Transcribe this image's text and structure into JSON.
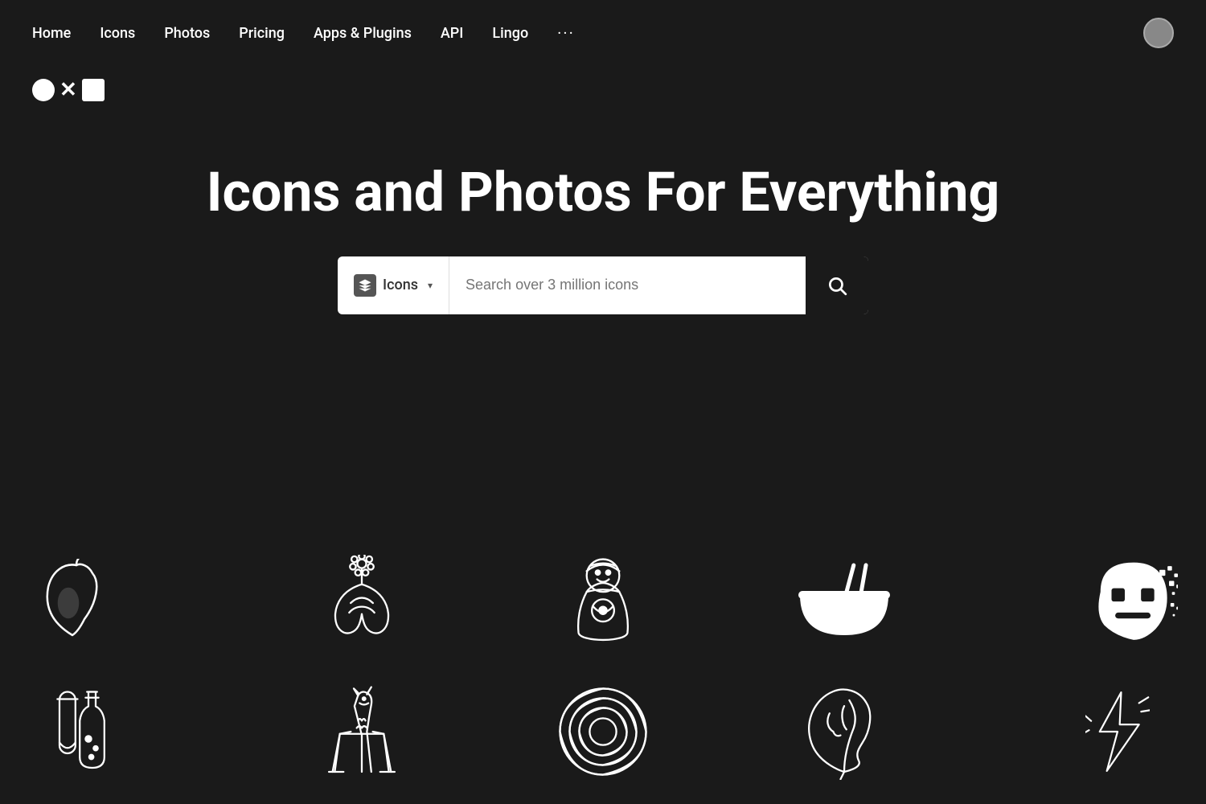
{
  "nav": {
    "items": [
      {
        "label": "Home",
        "id": "home"
      },
      {
        "label": "Icons",
        "id": "icons"
      },
      {
        "label": "Photos",
        "id": "photos"
      },
      {
        "label": "Pricing",
        "id": "pricing"
      },
      {
        "label": "Apps & Plugins",
        "id": "apps"
      },
      {
        "label": "API",
        "id": "api"
      },
      {
        "label": "Lingo",
        "id": "lingo"
      }
    ],
    "more_label": "···",
    "avatar_alt": "User avatar"
  },
  "logo": {
    "symbol": "○ × □"
  },
  "hero": {
    "title": "Icons and Photos For Everything",
    "search": {
      "type_label": "Icons",
      "placeholder": "Search over 3 million icons",
      "button_label": "Search"
    }
  },
  "colors": {
    "background": "#1a1a1a",
    "text": "#ffffff",
    "search_bg": "#ffffff",
    "search_btn": "#1a1a1a"
  }
}
